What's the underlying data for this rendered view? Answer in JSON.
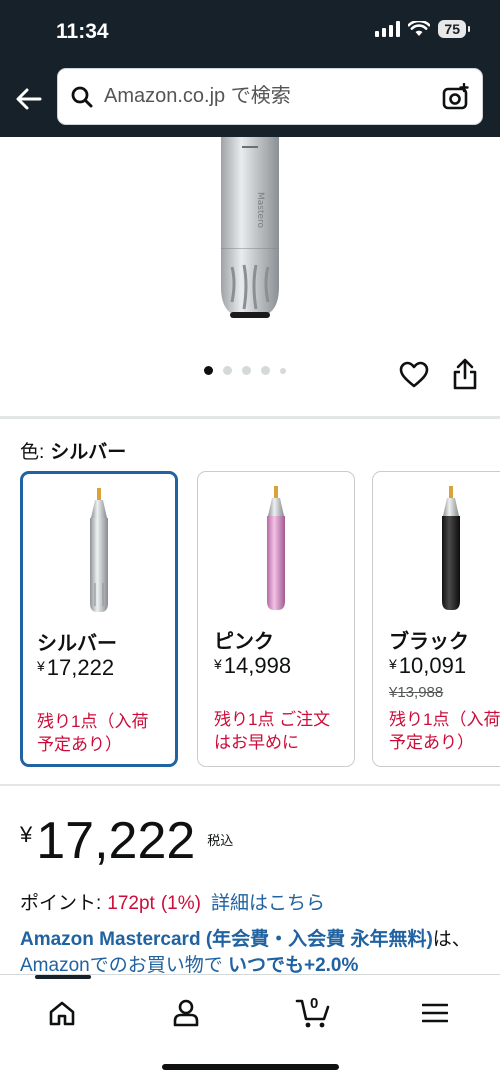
{
  "status": {
    "time": "11:34",
    "battery": "75"
  },
  "search": {
    "placeholder": "Amazon.co.jp で検索"
  },
  "gallery": {
    "dots": 5,
    "active_index": 0
  },
  "color": {
    "label": "色:",
    "selected": "シルバー",
    "options": [
      {
        "name": "シルバー",
        "price": "17,222",
        "stock": "残り1点（入荷\n予定あり）",
        "selected": true
      },
      {
        "name": "ピンク",
        "price": "14,998",
        "stock": "残り1点 ご注文\nはお早めに",
        "selected": false
      },
      {
        "name": "ブラック",
        "price": "10,091",
        "old_price": "¥13,988",
        "stock": "残り1点（入荷\n予定あり）",
        "selected": false
      }
    ],
    "currency": "¥"
  },
  "price": {
    "currency": "¥",
    "amount": "17,222",
    "tax_note": "税込"
  },
  "points": {
    "label": "ポイント:",
    "value": "172pt",
    "percent": "(1%)",
    "details_link": "詳細はこちら"
  },
  "mastercard": {
    "title": "Amazon Mastercard (年会費・入会費 永年無料)",
    "text1": "は、",
    "link": "Amazonでのお買い物で",
    "strong": " いつでも+2.0%"
  },
  "nav": {
    "cart_count": "0",
    "items": [
      "home-icon",
      "account-icon",
      "cart-icon",
      "menu-icon"
    ]
  },
  "colors": {
    "header_bg": "#16212a",
    "link": "#2162a1",
    "deal_red": "#cc0c39",
    "selected_border": "#2162a1"
  }
}
